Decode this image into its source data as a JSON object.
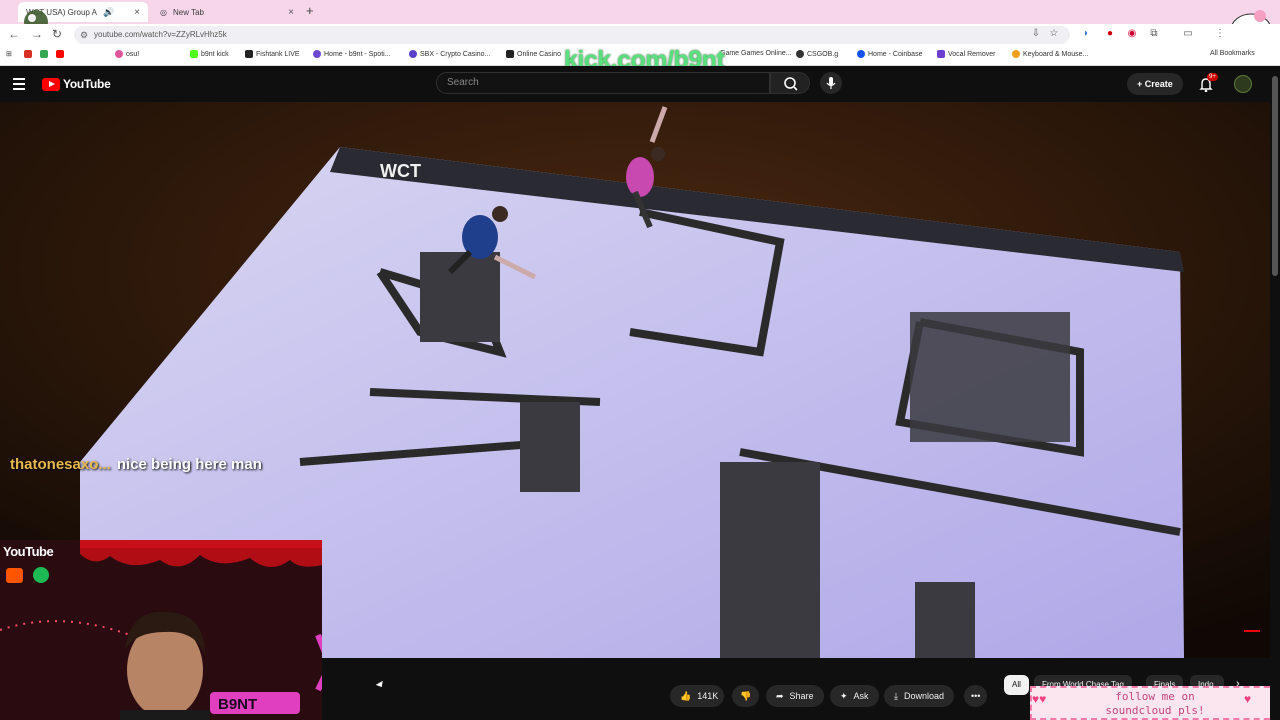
{
  "browser": {
    "tabs": [
      {
        "label": "WCT USA) Group A"
      },
      {
        "label": "New Tab"
      }
    ],
    "url": "youtube.com/watch?v=ZZyRLvHhz5k",
    "bookmarks": [
      "b9nt kick",
      "Fishtank LIVE",
      "Home - b9nt - Spoti...",
      "SBX - Crypto Casino...",
      "Online Casino",
      "Game Games Online...",
      "CSGOB.g",
      "Home - Coinbase",
      "Vocal Remover",
      "Keyboard & Mouse...",
      "All Bookmarks"
    ]
  },
  "overlay": {
    "kick_text": "kick.com/b9nt",
    "chat_user": "thatonesaxo...",
    "chat_message": "nice being here man",
    "webcam_label": "YouTube",
    "webcam_badge": "B9NT",
    "soundcloud_line1": "follow me on",
    "soundcloud_line2": "soundcloud pls!"
  },
  "youtube": {
    "logo": "YouTube",
    "search_placeholder": "Search",
    "create_label": "Create",
    "notif_badge": "9+",
    "video_floor_text": "WCT",
    "like_count": "141K",
    "share_label": "Share",
    "ask_label": "Ask",
    "download_label": "Download",
    "chips": [
      "All",
      "From World Chase Tag",
      "Finals",
      "Indo"
    ]
  },
  "colors": {
    "yt_red": "#ff0000",
    "kick_green": "#58e07c",
    "tab_pink": "#f7d6ea"
  }
}
